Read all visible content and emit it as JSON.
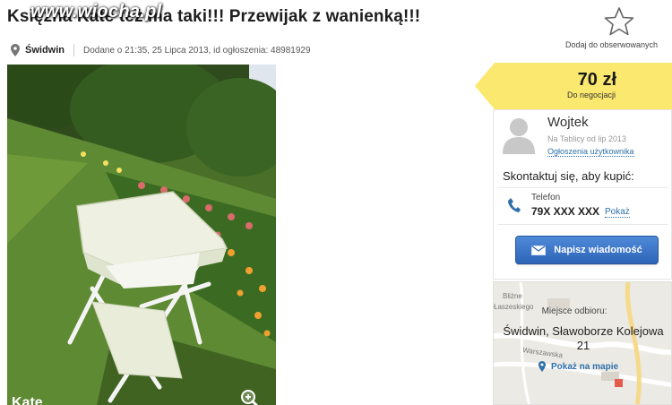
{
  "listing": {
    "title": "Księżna Kate też ma taki!!! Przewijak z wanienką!!!",
    "watermark": "www.wiocha.pl",
    "city": "Świdwin",
    "meta": "Dodane o 21:35, 25 Lipca 2013, id ogłoszenia: 48981929"
  },
  "observe": {
    "label": "Dodaj do obserwowanych",
    "icon": "star-icon"
  },
  "price": {
    "value": "70 zł",
    "note": "Do negocjacji",
    "tag_color": "#fbe86e"
  },
  "seller": {
    "name": "Wojtek",
    "since": "Na Tablicy od lip 2013",
    "ads_link": "Ogłoszenia użytkownika",
    "contact_prompt": "Skontaktuj się, aby kupić:",
    "phone_label": "Telefon",
    "phone_number": "79X XXX XXX",
    "show_phone": "Pokaż",
    "message_button": "Napisz wiadomość",
    "button_color": "#3a73c8"
  },
  "pickup": {
    "label": "Miejsce odbioru:",
    "address": "Świdwin, Sławoborze Kolejowa 21",
    "show_map": "Pokaż na mapie",
    "map_labels": [
      "Bliżne",
      "Łaszeskiego",
      "Warszawska"
    ]
  },
  "photo": {
    "caption": "Kate"
  },
  "icons": {
    "location": "map-pin-icon",
    "zoom": "zoom-icon",
    "phone": "phone-icon",
    "message": "envelope-icon",
    "avatar": "user-avatar-icon"
  }
}
